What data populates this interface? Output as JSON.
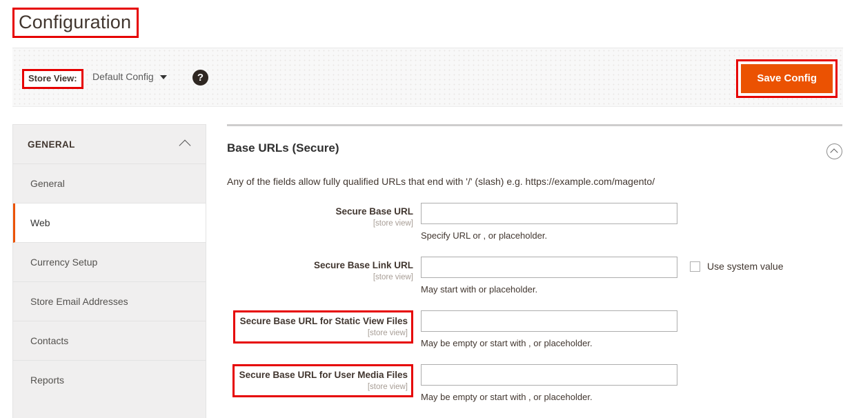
{
  "page": {
    "title": "Configuration"
  },
  "toolbar": {
    "store_view_label": "Store View:",
    "store_view_value": "Default Config",
    "help_icon_glyph": "?",
    "save_label": "Save Config",
    "accent_color": "#eb5202",
    "highlight_color": "#e60000"
  },
  "sidebar": {
    "section": {
      "title": "GENERAL",
      "expanded": true
    },
    "items": [
      {
        "label": "General",
        "active": false
      },
      {
        "label": "Web",
        "active": true
      },
      {
        "label": "Currency Setup",
        "active": false
      },
      {
        "label": "Store Email Addresses",
        "active": false
      },
      {
        "label": "Contacts",
        "active": false
      },
      {
        "label": "Reports",
        "active": false
      }
    ]
  },
  "content": {
    "section_title": "Base URLs (Secure)",
    "section_note": "Any of the fields allow fully qualified URLs that end with '/' (slash) e.g. https://example.com/magento/",
    "fields": [
      {
        "label": "Secure Base URL",
        "scope": "[store view]",
        "value": "",
        "placeholder": "",
        "note": "Specify URL or , or placeholder.",
        "highlighted": false,
        "has_system_value": false,
        "system_value_label": ""
      },
      {
        "label": "Secure Base Link URL",
        "scope": "[store view]",
        "value": "",
        "placeholder": "",
        "note": "May start with or placeholder.",
        "highlighted": false,
        "has_system_value": true,
        "system_value_label": "Use system value"
      },
      {
        "label": "Secure Base URL for Static View Files",
        "scope": "[store view]",
        "value": "",
        "placeholder": "",
        "note": "May be empty or start with , or placeholder.",
        "highlighted": true,
        "has_system_value": false,
        "system_value_label": ""
      },
      {
        "label": "Secure Base URL for User Media Files",
        "scope": "[store view]",
        "value": "",
        "placeholder": "",
        "note": "May be empty or start with , or placeholder.",
        "highlighted": true,
        "has_system_value": false,
        "system_value_label": ""
      }
    ]
  }
}
